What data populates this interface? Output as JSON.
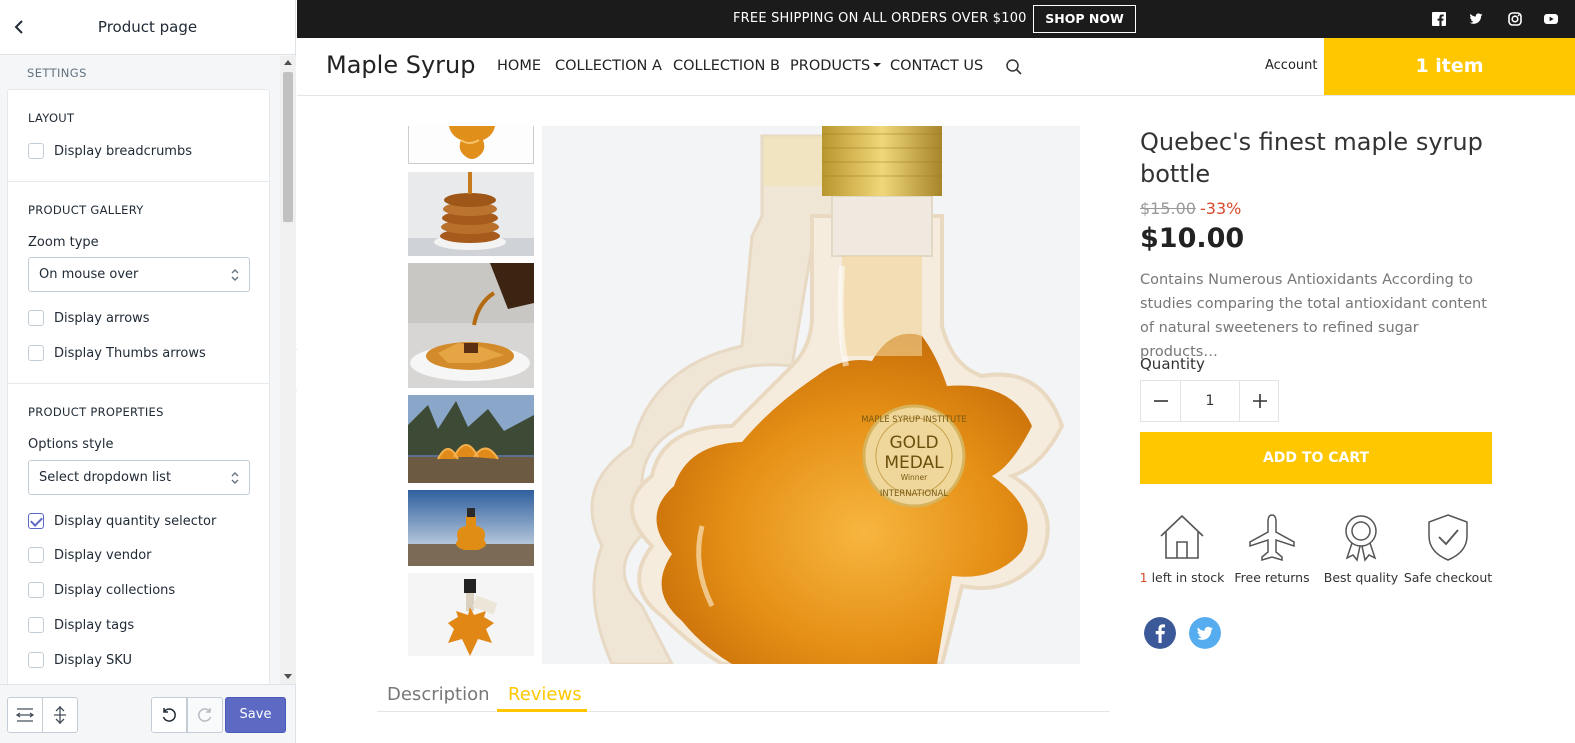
{
  "editor": {
    "title": "Product page",
    "settings_heading": "SETTINGS",
    "layout": {
      "heading": "LAYOUT",
      "display_breadcrumbs": {
        "label": "Display breadcrumbs",
        "checked": false
      }
    },
    "gallery": {
      "heading": "PRODUCT GALLERY",
      "zoom_label": "Zoom type",
      "zoom_value": "On mouse over",
      "display_arrows": {
        "label": "Display arrows",
        "checked": false
      },
      "display_thumbs_arrows": {
        "label": "Display Thumbs arrows",
        "checked": false
      }
    },
    "properties": {
      "heading": "PRODUCT PROPERTIES",
      "options_label": "Options style",
      "options_value": "Select dropdown list",
      "checks": [
        {
          "label": "Display quantity selector",
          "checked": true
        },
        {
          "label": "Display vendor",
          "checked": false
        },
        {
          "label": "Display collections",
          "checked": false
        },
        {
          "label": "Display tags",
          "checked": false
        },
        {
          "label": "Display SKU",
          "checked": false
        }
      ]
    },
    "save_label": "Save"
  },
  "store": {
    "announcement": "FREE SHIPPING ON ALL ORDERS OVER $100",
    "shop_now": "SHOP NOW",
    "logo": "Maple Syrup",
    "nav": [
      "HOME",
      "COLLECTION A",
      "COLLECTION B",
      "PRODUCTS",
      "CONTACT US"
    ],
    "account": "Account",
    "cart": "1 item"
  },
  "product": {
    "title": "Quebec's finest maple syrup bottle",
    "compare_price": "$15.00",
    "discount": "-33%",
    "price": "$10.00",
    "description": "Contains Numerous Antioxidants According to studies comparing the total antioxidant content of natural sweeteners to refined sugar products…",
    "quantity_label": "Quantity",
    "quantity": "1",
    "add_to_cart": "ADD TO CART",
    "label_text": {
      "line1": "MAPLE SYRUP INSTITUTE",
      "line2": "GOLD",
      "line3": "MEDAL",
      "line4": "Winner",
      "line5": "INTERNATIONAL"
    },
    "features": {
      "stock_count": "1",
      "stock_text": " left in stock",
      "returns": "Free returns",
      "quality": "Best quality",
      "checkout": "Safe checkout"
    },
    "tabs": [
      "Description",
      "Reviews"
    ],
    "active_tab": "Reviews"
  },
  "colors": {
    "accent": "#ffc700",
    "editor_primary": "#5c6ac4",
    "discount": "#d84a2b",
    "facebook": "#3b5998",
    "twitter": "#55acee"
  }
}
